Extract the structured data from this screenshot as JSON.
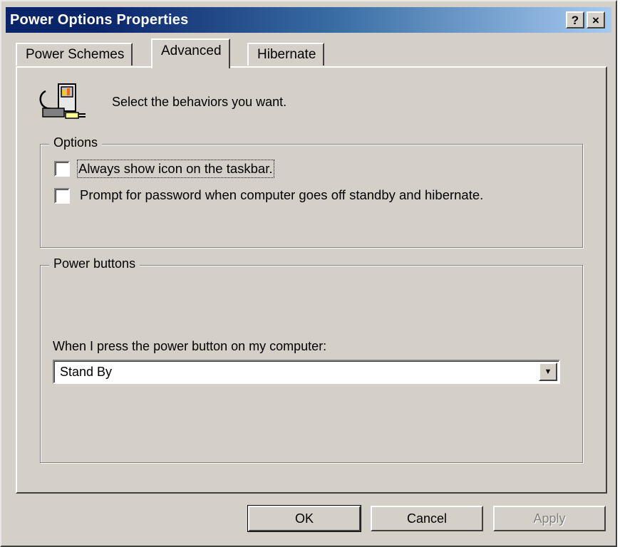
{
  "window": {
    "title": "Power Options Properties",
    "help_glyph": "?",
    "close_glyph": "×"
  },
  "tabs": [
    {
      "label": "Power Schemes",
      "active": false
    },
    {
      "label": "Advanced",
      "active": true
    },
    {
      "label": "Hibernate",
      "active": false
    }
  ],
  "header": {
    "icon": "power-plug-icon",
    "text": "Select the behaviors you want."
  },
  "options": {
    "label": "Options",
    "items": [
      {
        "label": "Always show icon on the taskbar.",
        "checked": false
      },
      {
        "label": "Prompt for password when computer goes off standby and hibernate.",
        "checked": false
      }
    ]
  },
  "power_buttons": {
    "label": "Power buttons",
    "prompt": "When I press the power button on my computer:",
    "selected": "Stand By"
  },
  "buttons": {
    "ok": "OK",
    "cancel": "Cancel",
    "apply": "Apply"
  },
  "colors": {
    "face": "#d4d0c8",
    "title_start": "#0a246a",
    "title_end": "#a6caf0"
  }
}
